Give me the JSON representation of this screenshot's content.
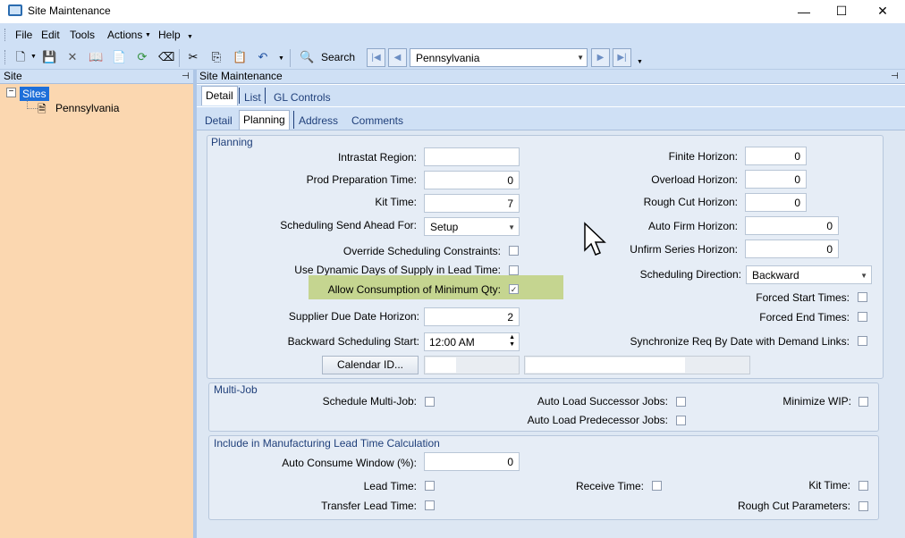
{
  "window": {
    "title": "Site Maintenance",
    "minimize": "—",
    "maximize": "☐",
    "close": "✕"
  },
  "menu": [
    "File",
    "Edit",
    "Tools",
    "Actions",
    "Help"
  ],
  "toolbar": {
    "search_label": "Search",
    "site_combo_value": "Pennsylvania"
  },
  "left": {
    "header": "Site",
    "tree_root": "Sites",
    "tree_child": "Pennsylvania"
  },
  "right": {
    "header": "Site Maintenance"
  },
  "tabs_top": [
    "Detail",
    "List",
    "GL Controls"
  ],
  "tabs_sub": [
    "Detail",
    "Planning",
    "Address",
    "Comments"
  ],
  "planning": {
    "title": "Planning",
    "intrastat_region": {
      "label": "Intrastat Region:",
      "value": ""
    },
    "prod_prep_time": {
      "label": "Prod Preparation Time:",
      "value": "0"
    },
    "kit_time": {
      "label": "Kit Time:",
      "value": "7"
    },
    "send_ahead": {
      "label": "Scheduling Send Ahead For:",
      "value": "Setup"
    },
    "override": {
      "label": "Override Scheduling Constraints:",
      "checked": false
    },
    "dynamic_days": {
      "label": "Use Dynamic Days of Supply in Lead Time:",
      "checked": false
    },
    "allow_min_qty": {
      "label": "Allow Consumption of Minimum Qty:",
      "checked": true,
      "mark": "✓"
    },
    "supplier_due": {
      "label": "Supplier Due Date Horizon:",
      "value": "2"
    },
    "backward_start": {
      "label": "Backward Scheduling Start:",
      "value": "12:00 AM"
    },
    "calendar_button": "Calendar ID...",
    "finite_horizon": {
      "label": "Finite Horizon:",
      "value": "0"
    },
    "overload_horizon": {
      "label": "Overload Horizon:",
      "value": "0"
    },
    "rough_cut_horizon": {
      "label": "Rough Cut Horizon:",
      "value": "0"
    },
    "auto_firm_horizon": {
      "label": "Auto Firm Horizon:",
      "value": "0"
    },
    "unfirm_series": {
      "label": "Unfirm Series Horizon:",
      "value": "0"
    },
    "sched_direction": {
      "label": "Scheduling Direction:",
      "value": "Backward"
    },
    "forced_start": {
      "label": "Forced Start Times:",
      "checked": false
    },
    "forced_end": {
      "label": "Forced End Times:",
      "checked": false
    },
    "sync_req": {
      "label": "Synchronize Req By Date with Demand Links:",
      "checked": false
    }
  },
  "multijob": {
    "title": "Multi-Job",
    "schedule": {
      "label": "Schedule Multi-Job:",
      "checked": false
    },
    "auto_successor": {
      "label": "Auto Load Successor Jobs:",
      "checked": false
    },
    "auto_predecessor": {
      "label": "Auto Load Predecessor Jobs:",
      "checked": false
    },
    "minimize_wip": {
      "label": "Minimize WIP:",
      "checked": false
    }
  },
  "leadtime": {
    "title": "Include in Manufacturing Lead Time Calculation",
    "auto_consume": {
      "label": "Auto Consume Window (%):",
      "value": "0"
    },
    "lead_time": {
      "label": "Lead Time:",
      "checked": false
    },
    "receive_time": {
      "label": "Receive Time:",
      "checked": false
    },
    "kit_time": {
      "label": "Kit Time:",
      "checked": false
    },
    "transfer_lead": {
      "label": "Transfer Lead Time:",
      "checked": false
    },
    "rough_cut_params": {
      "label": "Rough Cut Parameters:",
      "checked": false
    }
  }
}
